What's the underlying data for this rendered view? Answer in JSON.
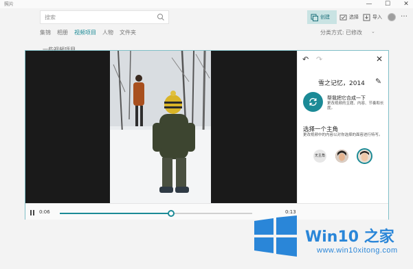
{
  "app": {
    "title": "照片"
  },
  "window_controls": {
    "minimize": "—",
    "maximize": "☐",
    "close": "✕"
  },
  "search": {
    "placeholder": "搜索"
  },
  "toolbar": {
    "create": "创建",
    "select": "选择",
    "import": "导入",
    "more": "…"
  },
  "tabs": [
    {
      "label": "集锦"
    },
    {
      "label": "相册"
    },
    {
      "label": "视频项目",
      "active": true
    },
    {
      "label": "人物"
    },
    {
      "label": "文件夹"
    }
  ],
  "sort": {
    "label": "分类方式:",
    "value": "已修改",
    "chevron": "⌄"
  },
  "background_text": "一些视频项目",
  "player": {
    "current_time": "0:06",
    "total_time": "0:13",
    "progress": 0.58
  },
  "side_panel": {
    "undo": "↶",
    "redo": "↷",
    "close": "✕",
    "video_title": "雪之记忆，2014",
    "edit": "✎",
    "remix_heading": "帮我把它合成一下",
    "remix_desc": "更改视频的主题、内容、节奏和长度。",
    "star_heading": "选择一个主角",
    "star_desc": "更改视频中的内容以对你选择的面容进行特写。",
    "star_none": "无主角"
  },
  "watermark": {
    "brand": "Win10 之家",
    "url": "www.win10xitong.com"
  },
  "colors": {
    "accent": "#1b8a96",
    "video_bg": "#1a1a1a",
    "watermark": "#2a86d8"
  }
}
